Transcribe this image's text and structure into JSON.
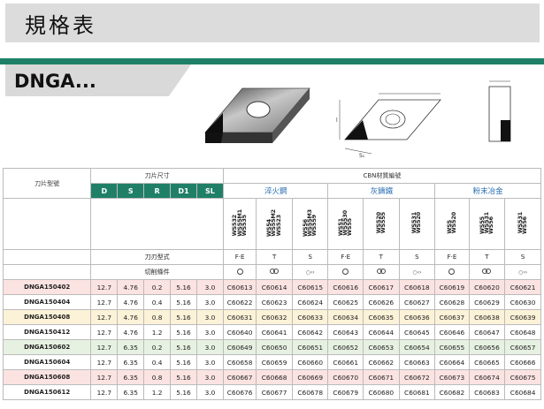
{
  "header": {
    "title": "規格表"
  },
  "product": {
    "title": "DNGA..."
  },
  "table": {
    "model_label": "刀片型號",
    "size_label": "刀片尺寸",
    "material_label": "CBN材質編號",
    "cols": [
      "D",
      "S",
      "R",
      "D1",
      "SL"
    ],
    "groups": [
      "淬火鋼",
      "灰鑄鐵",
      "粉末冶金"
    ],
    "grades": [
      "WS532",
      "WS55M1",
      "WS535",
      "WS54",
      "WS55M2",
      "WS523",
      "WS56",
      "WS55M3",
      "WS559",
      "WS51",
      "WS5530",
      "WS55",
      "WS520",
      "WS555",
      "WS531",
      "WS520",
      "WS5",
      "WS520",
      "WS55",
      "WS531",
      "WS56",
      "WS531",
      "WS56"
    ],
    "edge_label": "刀刃型式",
    "cond_label": "切削條件",
    "edge_types": [
      "F·E",
      "T",
      "S",
      "F·E",
      "T",
      "S",
      "F·E",
      "T",
      "S"
    ],
    "rows": [
      {
        "name": "DNGA150402",
        "d": "12.7",
        "s": "4.76",
        "r": "0.2",
        "d1": "5.16",
        "sl": "3.0",
        "c": [
          "C60613",
          "C60614",
          "C60615",
          "C60616",
          "C60617",
          "C60618",
          "C60619",
          "C60620",
          "C60621"
        ]
      },
      {
        "name": "DNGA150404",
        "d": "12.7",
        "s": "4.76",
        "r": "0.4",
        "d1": "5.16",
        "sl": "3.0",
        "c": [
          "C60622",
          "C60623",
          "C60624",
          "C60625",
          "C60626",
          "C60627",
          "C60628",
          "C60629",
          "C60630"
        ]
      },
      {
        "name": "DNGA150408",
        "d": "12.7",
        "s": "4.76",
        "r": "0.8",
        "d1": "5.16",
        "sl": "3.0",
        "c": [
          "C60631",
          "C60632",
          "C60633",
          "C60634",
          "C60635",
          "C60636",
          "C60637",
          "C60638",
          "C60639"
        ]
      },
      {
        "name": "DNGA150412",
        "d": "12.7",
        "s": "4.76",
        "r": "1.2",
        "d1": "5.16",
        "sl": "3.0",
        "c": [
          "C60640",
          "C60641",
          "C60642",
          "C60643",
          "C60644",
          "C60645",
          "C60646",
          "C60647",
          "C60648"
        ]
      },
      {
        "name": "DNGA150602",
        "d": "12.7",
        "s": "6.35",
        "r": "0.2",
        "d1": "5.16",
        "sl": "3.0",
        "c": [
          "C60649",
          "C60650",
          "C60651",
          "C60652",
          "C60653",
          "C60654",
          "C60655",
          "C60656",
          "C60657"
        ]
      },
      {
        "name": "DNGA150604",
        "d": "12.7",
        "s": "6.35",
        "r": "0.4",
        "d1": "5.16",
        "sl": "3.0",
        "c": [
          "C60658",
          "C60659",
          "C60660",
          "C60661",
          "C60662",
          "C60663",
          "C60664",
          "C60665",
          "C60666"
        ]
      },
      {
        "name": "DNGA150608",
        "d": "12.7",
        "s": "6.35",
        "r": "0.8",
        "d1": "5.16",
        "sl": "3.0",
        "c": [
          "C60667",
          "C60668",
          "C60669",
          "C60670",
          "C60671",
          "C60672",
          "C60673",
          "C60674",
          "C60675"
        ]
      },
      {
        "name": "DNGA150612",
        "d": "12.7",
        "s": "6.35",
        "r": "1.2",
        "d1": "5.16",
        "sl": "3.0",
        "c": [
          "C60676",
          "C60677",
          "C60678",
          "C60679",
          "C60680",
          "C60681",
          "C60682",
          "C60683",
          "C60684"
        ]
      }
    ]
  },
  "colors": {
    "accent_green": "#1f8067",
    "row_pink": "#fbe3e2",
    "row_yellow": "#fcf2d8",
    "row_green": "#e7f1e2"
  }
}
